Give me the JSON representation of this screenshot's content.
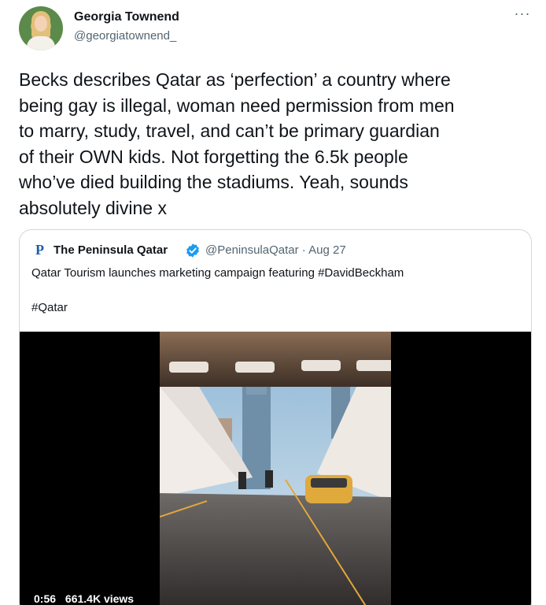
{
  "tweet": {
    "author_name": "Georgia Townend",
    "author_handle": "@georgiatownend_",
    "more_icon": "more-horizontal-icon",
    "text": "Becks describes Qatar as ‘perfection’ a country where\nbeing gay is illegal, woman need permission from men\nto marry, study, travel, and can’t be primary guardian\nof their OWN kids. Not forgetting the 6.5k people\nwho’ve died building the stadiums. Yeah, sounds\nabsolutely divine x"
  },
  "quote": {
    "logo_letter": "P",
    "name": "The Peninsula Qatar",
    "verified_icon": "verified-badge-icon",
    "handle_date": "@PeninsulaQatar · Aug 27",
    "text": "Qatar Tourism launches marketing campaign featuring #DavidBeckham",
    "hashtag": "#Qatar",
    "video": {
      "duration": "0:56",
      "views": "661.4K views"
    }
  },
  "colors": {
    "text_primary": "#0f1419",
    "text_secondary": "#536471",
    "border": "#cfd9de",
    "verified_blue": "#1d9bf0",
    "peninsula_blue": "#1d5fa8"
  }
}
